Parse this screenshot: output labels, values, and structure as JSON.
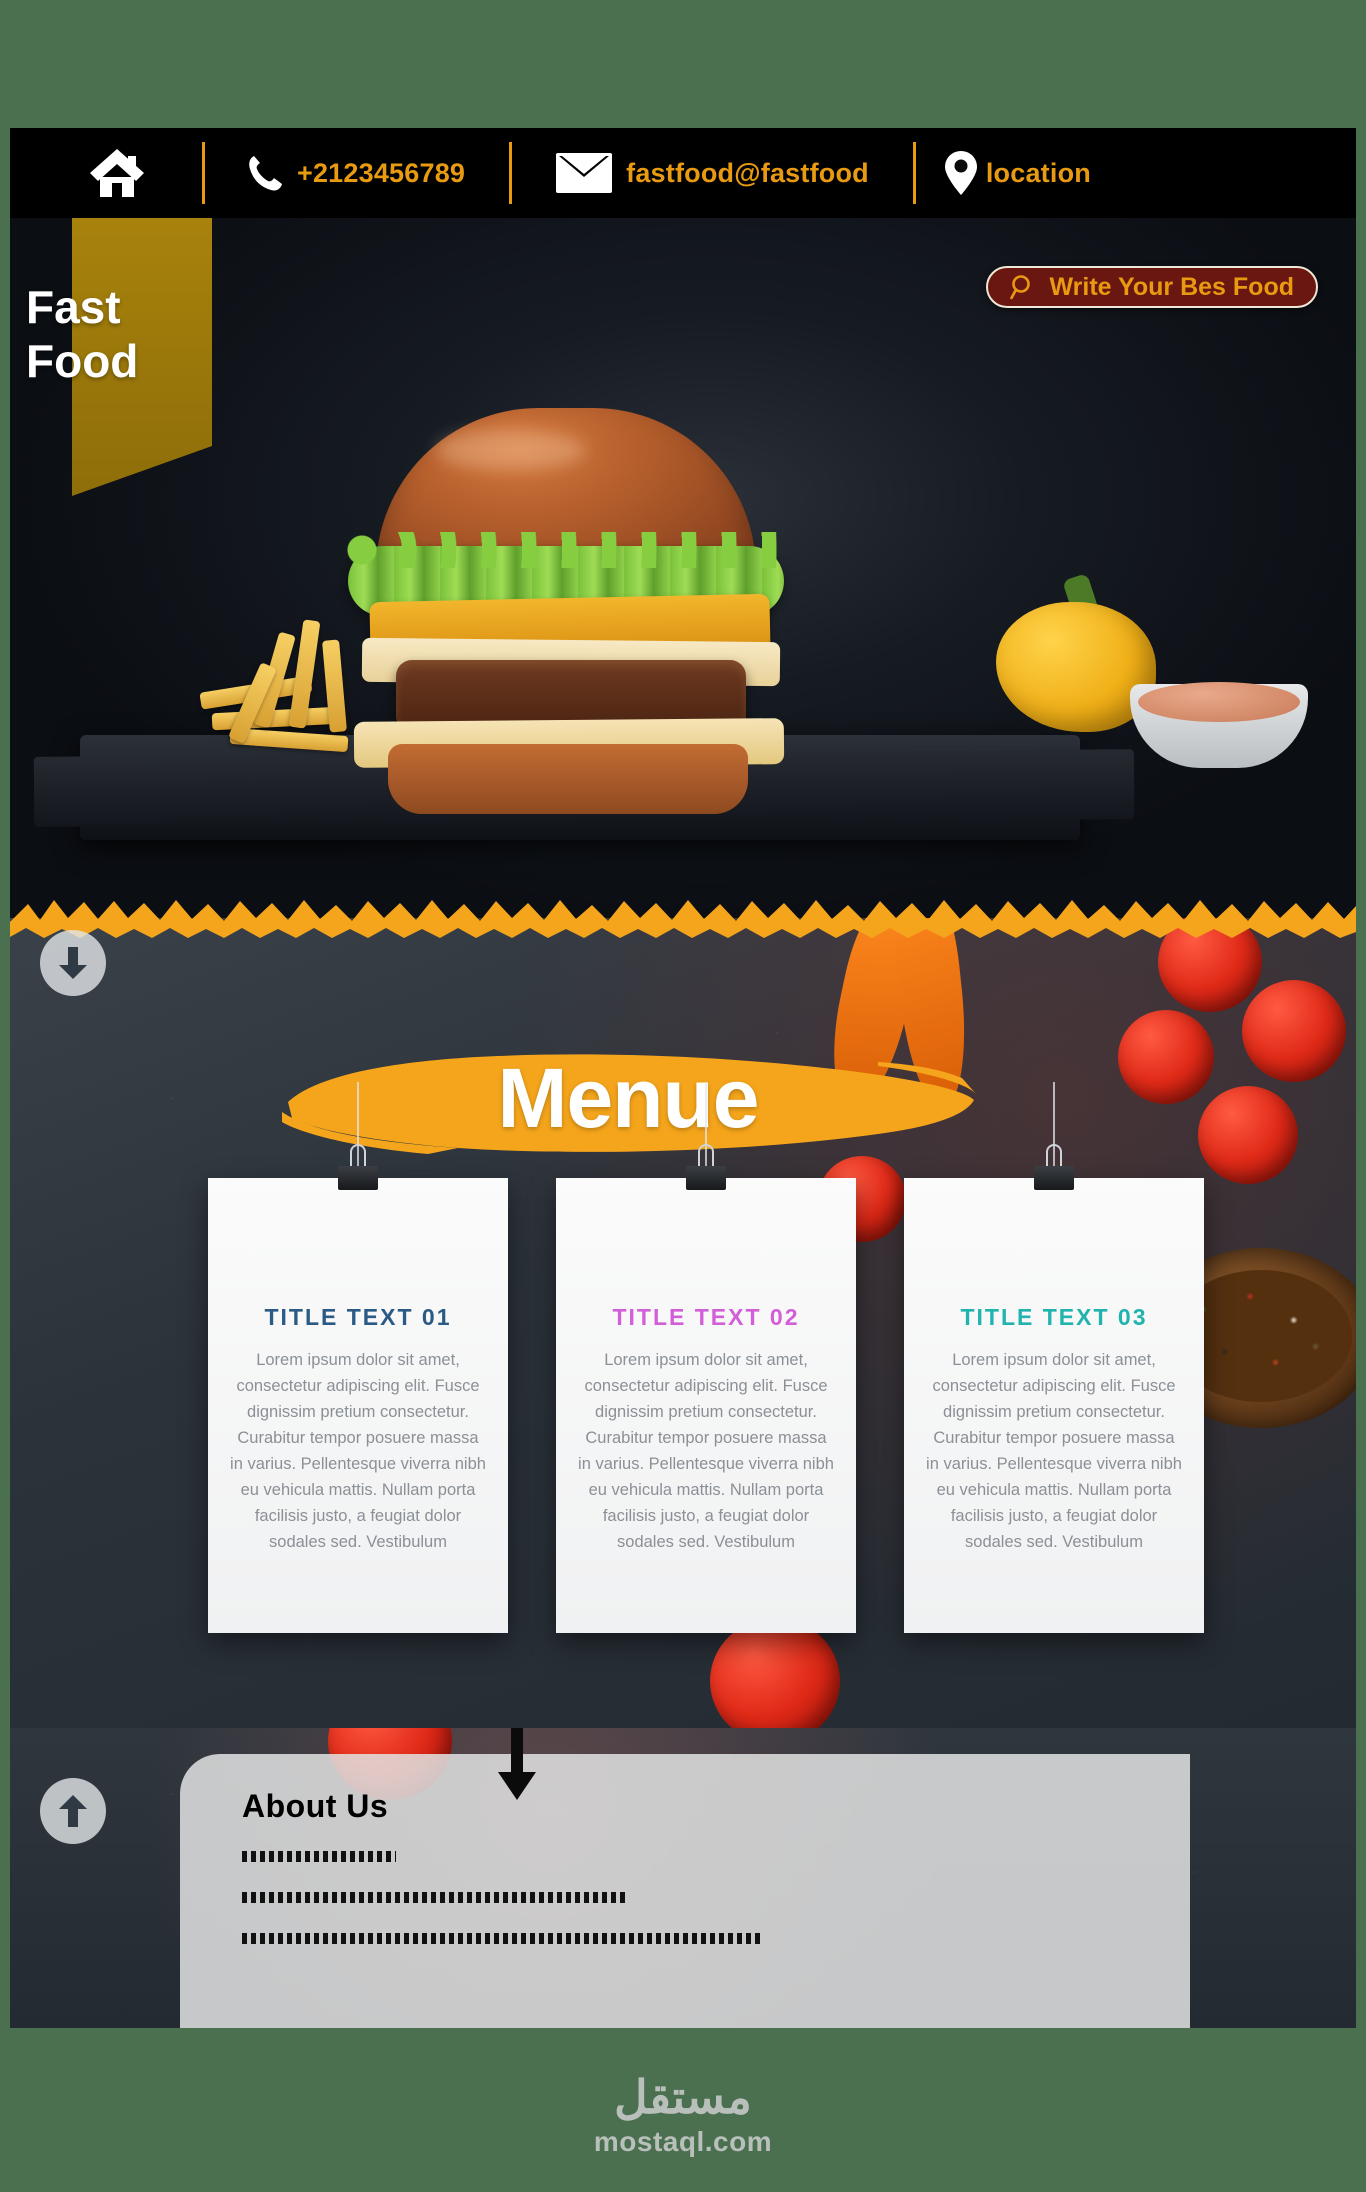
{
  "page": {
    "background_color": "#4a7050",
    "accent_orange": "#e89a10",
    "brush_yellow": "#f5a51b",
    "ribbon_gold": "#a8820c",
    "search_bg": "#6a1611"
  },
  "topbar": {
    "home_icon": "home-icon",
    "items": [
      {
        "icon": "phone-icon",
        "label": "+2123456789"
      },
      {
        "icon": "envelope-icon",
        "label": "fastfood@fastfood"
      },
      {
        "icon": "map-pin-icon",
        "label": "location"
      }
    ]
  },
  "hero": {
    "ribbon_line1": "Fast",
    "ribbon_line2": "Food",
    "search": {
      "icon": "search-icon",
      "value": "Write Your Bes Food",
      "placeholder": "Write Your Bes Food"
    }
  },
  "menu": {
    "title": "Menue",
    "scroll_down_icon": "arrow-down-circle-icon",
    "cards": [
      {
        "title": "TITLE TEXT 01",
        "title_color": "#2b5a84",
        "body": "Lorem ipsum dolor sit amet, consectetur adipiscing elit. Fusce dignissim pretium consectetur. Curabitur tempor posuere massa in varius. Pellentesque viverra nibh eu vehicula mattis. Nullam porta facilisis justo, a feugiat dolor sodales sed. Vestibulum"
      },
      {
        "title": "TITLE TEXT 02",
        "title_color": "#d35fd8",
        "body": "Lorem ipsum dolor sit amet, consectetur adipiscing elit. Fusce dignissim pretium consectetur. Curabitur tempor posuere massa in varius. Pellentesque viverra nibh eu vehicula mattis. Nullam porta facilisis justo, a feugiat dolor sodales sed. Vestibulum"
      },
      {
        "title": "TITLE TEXT 03",
        "title_color": "#21b3ae",
        "body": "Lorem ipsum dolor sit amet, consectetur adipiscing elit. Fusce dignissim pretium consectetur. Curabitur tempor posuere massa in varius. Pellentesque viverra nibh eu vehicula mattis. Nullam porta facilisis justo, a feugiat dolor sodales sed. Vestibulum"
      }
    ]
  },
  "about": {
    "title": "About Us",
    "scroll_up_icon": "arrow-up-circle-icon",
    "pointer_icon": "arrow-down-icon",
    "placeholder_lines": [
      18,
      46,
      60
    ]
  },
  "footer": {
    "logo_arabic": "مستقل",
    "logo_latin": "mostaql.com"
  }
}
